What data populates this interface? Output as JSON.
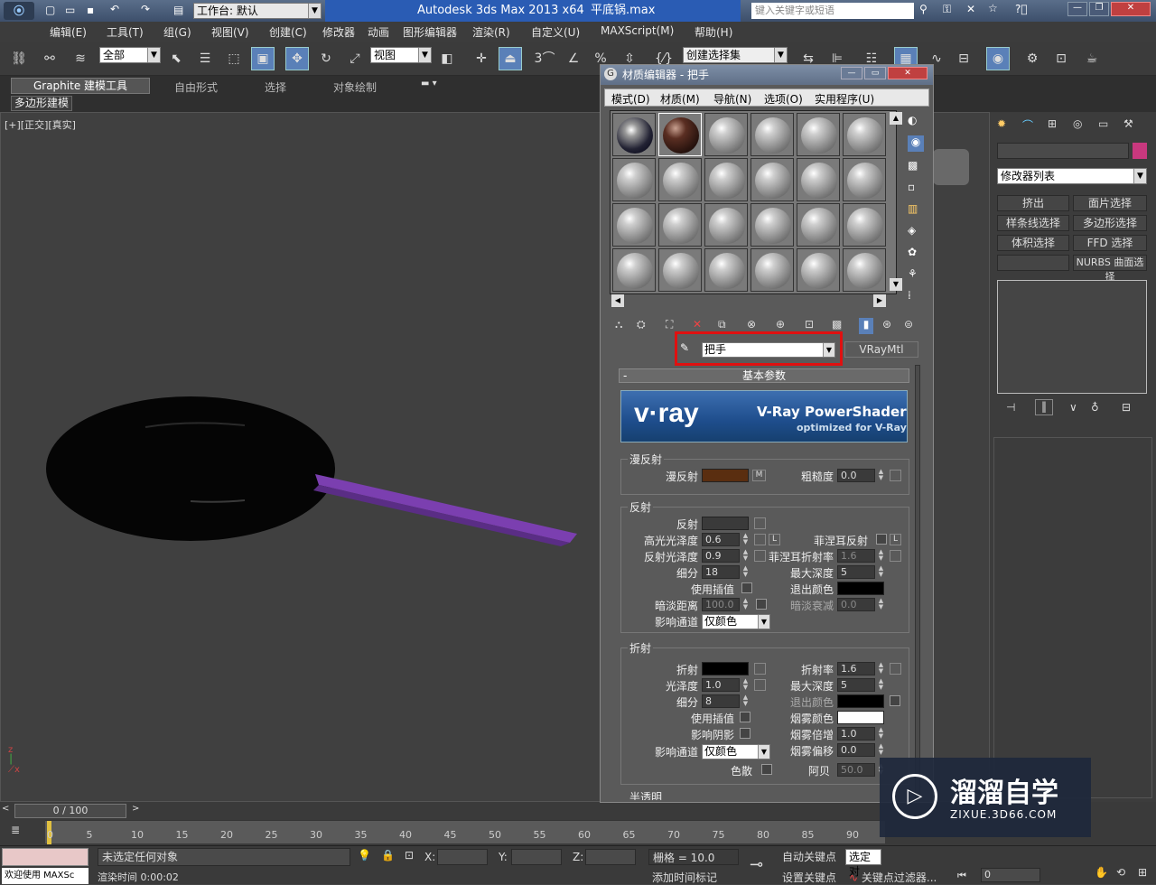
{
  "app": {
    "workspace_label": "工作台: 默认",
    "title": "Autodesk 3ds Max  2013 x64",
    "filename": "平底锅.max",
    "search_placeholder": "键入关键字或短语"
  },
  "menu": [
    "编辑(E)",
    "工具(T)",
    "组(G)",
    "视图(V)",
    "创建(C)",
    "修改器",
    "动画",
    "图形编辑器",
    "渲染(R)",
    "自定义(U)",
    "MAXScript(M)",
    "帮助(H)"
  ],
  "toolbar": {
    "selection_filter": "全部",
    "ref_coord": "视图",
    "snap_value": "3",
    "named_selection": "创建选择集"
  },
  "ribbon": {
    "tabs": [
      "Graphite 建模工具",
      "自由形式",
      "选择",
      "对象绘制"
    ],
    "subtab": "多边形建模"
  },
  "viewport": {
    "label": "[+][正交][真实]"
  },
  "material_editor": {
    "title": "材质编辑器 - 把手",
    "menu": [
      "模式(D)",
      "材质(M)",
      "导航(N)",
      "选项(O)",
      "实用程序(U)"
    ],
    "material_name": "把手",
    "material_type": "VRayMtl",
    "rollout_title": "基本参数",
    "banner_title": "V-Ray PowerShader",
    "banner_sub": "optimized for V-Ray",
    "banner_logo": "v·ray",
    "diffuse": {
      "group": "漫反射",
      "label": "漫反射",
      "map_btn": "M",
      "roughness_label": "粗糙度",
      "roughness": "0.0",
      "color": "#5a2e10"
    },
    "reflection": {
      "group": "反射",
      "reflect_label": "反射",
      "hilight_gloss_label": "高光光泽度",
      "hilight_gloss": "0.6",
      "lock_btn": "L",
      "fresnel_label": "菲涅耳反射",
      "fresnel_ior_label": "菲涅耳折射率",
      "fresnel_ior": "1.6",
      "refl_gloss_label": "反射光泽度",
      "refl_gloss": "0.9",
      "subdivs_label": "细分",
      "subdivs": "18",
      "max_depth_label": "最大深度",
      "max_depth": "5",
      "use_interp_label": "使用插值",
      "exit_color_label": "退出颜色",
      "dim_dist_label": "暗淡距离",
      "dim_dist": "100.0",
      "dim_falloff_label": "暗淡衰减",
      "dim_falloff": "0.0",
      "affect_channels_label": "影响通道",
      "affect_channels": "仅颜色"
    },
    "refraction": {
      "group": "折射",
      "refract_label": "折射",
      "ior_label": "折射率",
      "ior": "1.6",
      "gloss_label": "光泽度",
      "gloss": "1.0",
      "max_depth_label": "最大深度",
      "max_depth": "5",
      "subdivs_label": "细分",
      "subdivs": "8",
      "exit_color_label": "退出颜色",
      "use_interp_label": "使用插值",
      "fog_color_label": "烟雾颜色",
      "affect_shadows_label": "影响阴影",
      "fog_mult_label": "烟雾倍增",
      "fog_mult": "1.0",
      "affect_channels_label": "影响通道",
      "affect_channels": "仅颜色",
      "fog_bias_label": "烟雾偏移",
      "fog_bias": "0.0",
      "dispersion_label": "色散",
      "abbe_label": "阿贝",
      "abbe": "50.0"
    },
    "translucency_group": "半透明"
  },
  "command_panel": {
    "modifier_list": "修改器列表",
    "buttons": [
      "挤出",
      "面片选择",
      "样条线选择",
      "多边形选择",
      "体积选择",
      "FFD 选择",
      "",
      "NURBS 曲面选择"
    ]
  },
  "timeline": {
    "frame_display": "0 / 100",
    "ticks": [
      "0",
      "5",
      "10",
      "15",
      "20",
      "25",
      "30",
      "35",
      "40",
      "45",
      "50",
      "55",
      "60",
      "65",
      "70",
      "75",
      "80",
      "85",
      "90"
    ]
  },
  "status": {
    "welcome": "欢迎使用 MAXSc",
    "selection": "未选定任何对象",
    "render_time": "渲染时间  0:00:02",
    "x_label": "X:",
    "y_label": "Y:",
    "z_label": "Z:",
    "grid": "栅格 = 10.0",
    "auto_key": "自动关键点",
    "set_key": "设置关键点",
    "selected_dropdown": "选定对",
    "key_filters": "关键点过滤器...",
    "add_time_tag": "添加时间标记",
    "frame_spinner": "0"
  },
  "watermark": {
    "name": "溜溜自学",
    "url": "ZIXUE.3D66.COM"
  },
  "colors": {
    "highlight_box": "#e01010",
    "handle_purple": "#7b3fb0",
    "accent_blue": "#5a80b8"
  }
}
